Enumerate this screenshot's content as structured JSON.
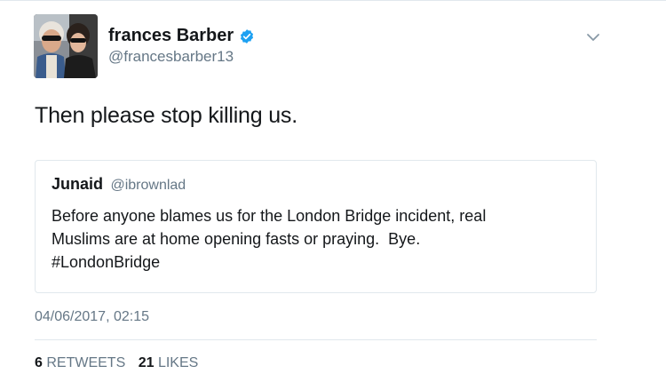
{
  "tweet": {
    "author": {
      "display_name": "frances Barber",
      "handle": "@francesbarber13",
      "verified": true,
      "verified_icon": "verified-badge-icon",
      "avatar": "profile-photo-two-people-sunglasses"
    },
    "menu_icon": "chevron-down-icon",
    "text": "Then please stop killing us.",
    "quoted": {
      "display_name": "Junaid",
      "handle": "@ibrownlad",
      "lines": [
        "Before anyone blames us for the London Bridge incident, real",
        "Muslims are at home opening fasts or praying.  Bye.",
        "#LondonBridge"
      ]
    },
    "timestamp": "04/06/2017, 02:15",
    "stats": {
      "retweets_count": "6",
      "retweets_label": "RETWEETS",
      "likes_count": "21",
      "likes_label": "LIKES"
    }
  },
  "colors": {
    "text": "#14171a",
    "secondary": "#657786",
    "border": "#e1e8ed",
    "verified_blue": "#1da1f2"
  }
}
